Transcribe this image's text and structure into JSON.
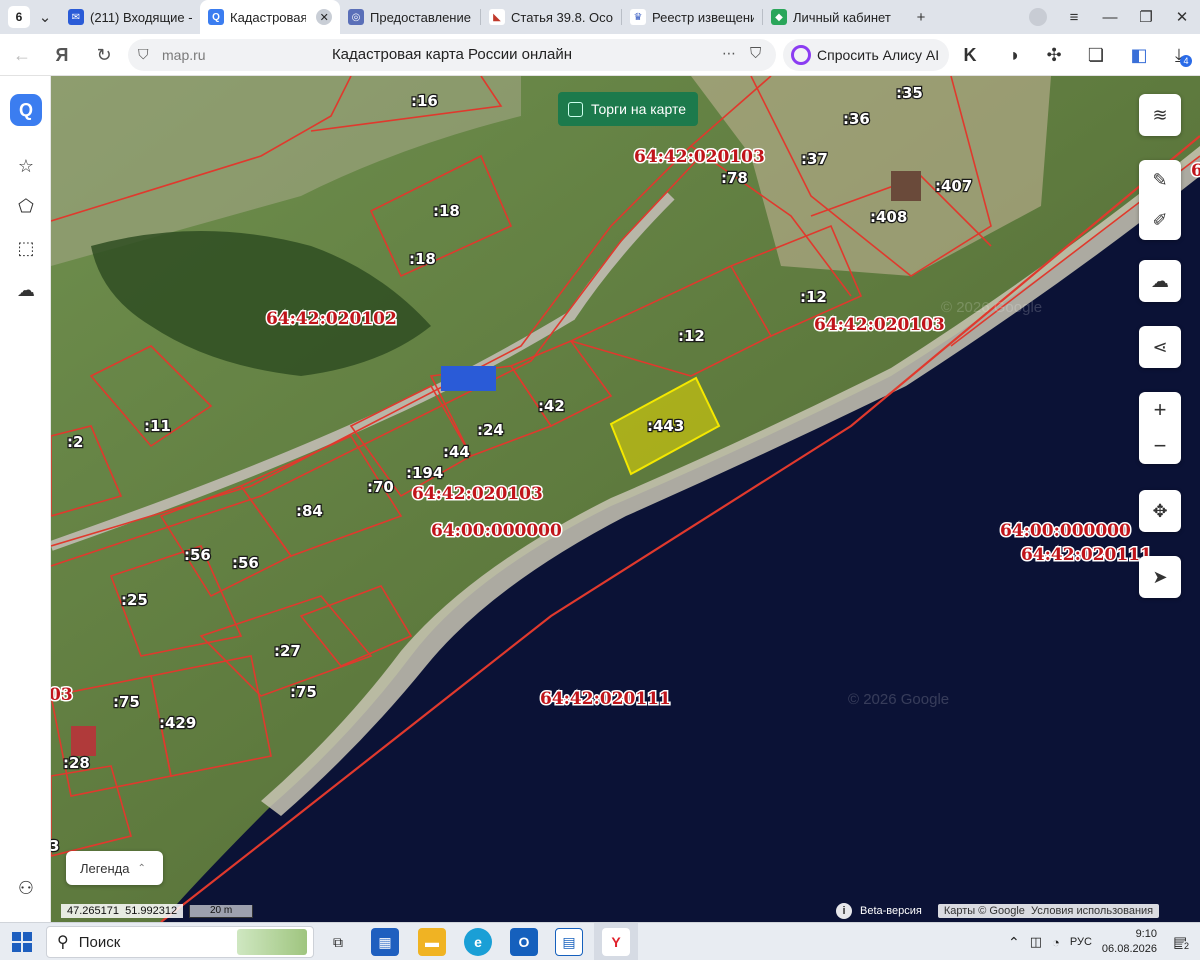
{
  "tabs": {
    "count": "6",
    "items": [
      {
        "label": "(211) Входящие -",
        "icon": "mail-icon",
        "color": "#2a5bd7"
      },
      {
        "label": "Кадастровая к",
        "icon": "map-app-icon",
        "color": "#3b7df0",
        "active": true
      },
      {
        "label": "Предоставление",
        "icon": "gov-icon",
        "color": "#5a6fb8"
      },
      {
        "label": "Статья 39.8. Особ",
        "icon": "flag-icon",
        "color": "#c0392b"
      },
      {
        "label": "Реестр извещени",
        "icon": "emblem-icon",
        "color": "#3a5ec2"
      },
      {
        "label": "Личный кабинет",
        "icon": "cabinet-icon",
        "color": "#2aa65a"
      }
    ]
  },
  "address": {
    "host": "map.ru",
    "title": "Кадастровая карта России онлайн",
    "alice": "Спросить Алису AI",
    "downloads_badge": "4"
  },
  "map": {
    "torgi": "Торги на карте",
    "legend": "Легенда",
    "lat": "47.265171",
    "lon": "51.992312",
    "scale": "20 m",
    "beta": "Beta-версия",
    "attribution": "Карты © Google",
    "terms": "Условия использования",
    "watermark": "© 2026 Google",
    "labels": {
      "q102": "64:42:020102",
      "q103a": "64:42:020103",
      "q103b": "64:42:020103",
      "q103c": "64:42:020103",
      "q000a": "64:00:000000",
      "q000b": "64:00:000000",
      "q111a": "64:42:020111",
      "q111b": "64:42:020111",
      "p16": ":16",
      "p18a": ":18",
      "p18b": ":18",
      "p35": ":35",
      "p36": ":36",
      "p37": ":37",
      "p78": ":78",
      "p407": ":407",
      "p408": ":408",
      "p12a": ":12",
      "p12b": ":12",
      "p42": ":42",
      "p443": ":443",
      "p24": ":24",
      "p44": ":44",
      "p194": ":194",
      "p70": ":70",
      "p84": ":84",
      "p11": ":11",
      "p2": ":2",
      "p56a": ":56",
      "p56b": ":56",
      "p25": ":25",
      "p27": ":27",
      "p75a": ":75",
      "p75b": ":75",
      "p429": ":429",
      "p28": ":28",
      "p3": "3",
      "p03": "03",
      "p6": "6"
    }
  },
  "taskbar": {
    "search": "Поиск",
    "lang": "РУС",
    "time": "9:10",
    "date": "06.08.2026",
    "notif": "2"
  }
}
